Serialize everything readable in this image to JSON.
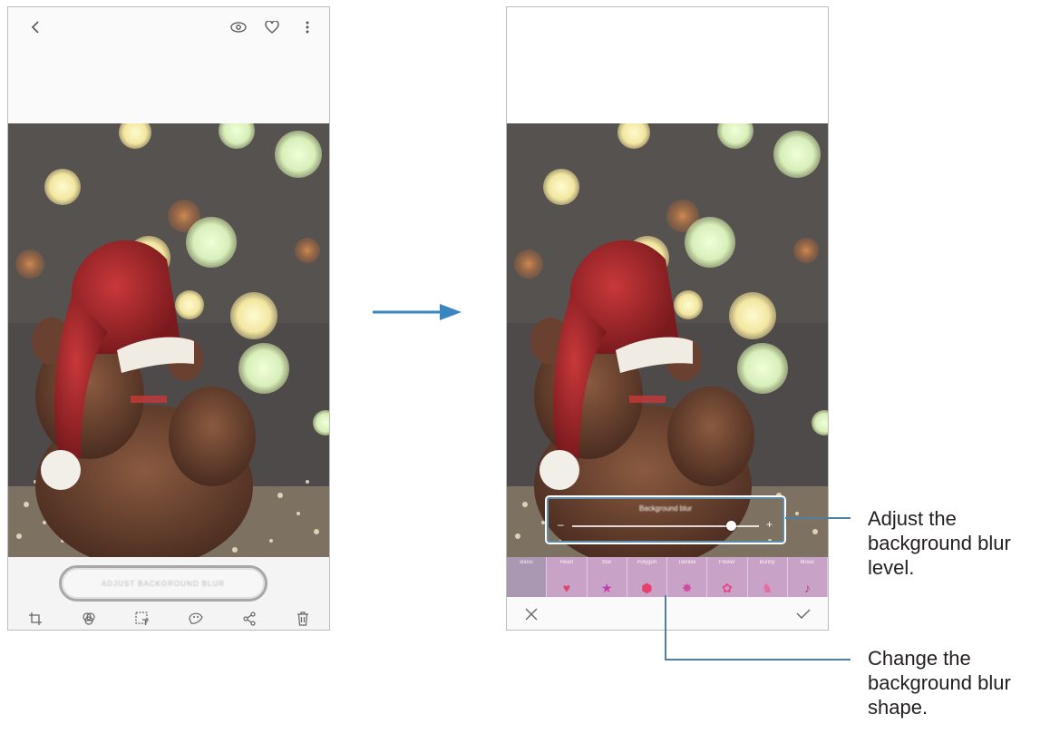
{
  "left_screen": {
    "adjust_button_label": "ADJUST BACKGROUND BLUR",
    "top_icons": [
      "back-chevron-icon",
      "bixby-vision-icon",
      "heart-icon",
      "more-options-icon"
    ],
    "toolbar_icons": [
      "crop-icon",
      "filter-icon",
      "text-icon",
      "brush-icon",
      "share-icon",
      "trash-icon"
    ]
  },
  "right_screen": {
    "slider": {
      "title": "Background blur",
      "minus": "–",
      "plus": "+",
      "level": 0.85
    },
    "shapes": [
      {
        "label": "Basic",
        "glyph": "",
        "selected": true
      },
      {
        "label": "Heart",
        "glyph": "♥",
        "selected": false
      },
      {
        "label": "Star",
        "glyph": "★",
        "selected": false
      },
      {
        "label": "Polygon",
        "glyph": "⬢",
        "selected": false
      },
      {
        "label": "Twinkle",
        "glyph": "✸",
        "selected": false
      },
      {
        "label": "Flower",
        "glyph": "✿",
        "selected": false
      },
      {
        "label": "Bunny",
        "glyph": "♞",
        "selected": false
      },
      {
        "label": "Music",
        "glyph": "♪",
        "selected": false
      }
    ],
    "cancel_icon": "close-icon",
    "apply_icon": "check-icon"
  },
  "callouts": {
    "blur_level": "Adjust the\nbackground blur\nlevel.",
    "blur_shape": "Change the\nbackground blur\nshape."
  },
  "colors": {
    "accent": "#4f7fa0",
    "arrow": "#3a86c2",
    "shape_strip": "#c9a3c7"
  }
}
